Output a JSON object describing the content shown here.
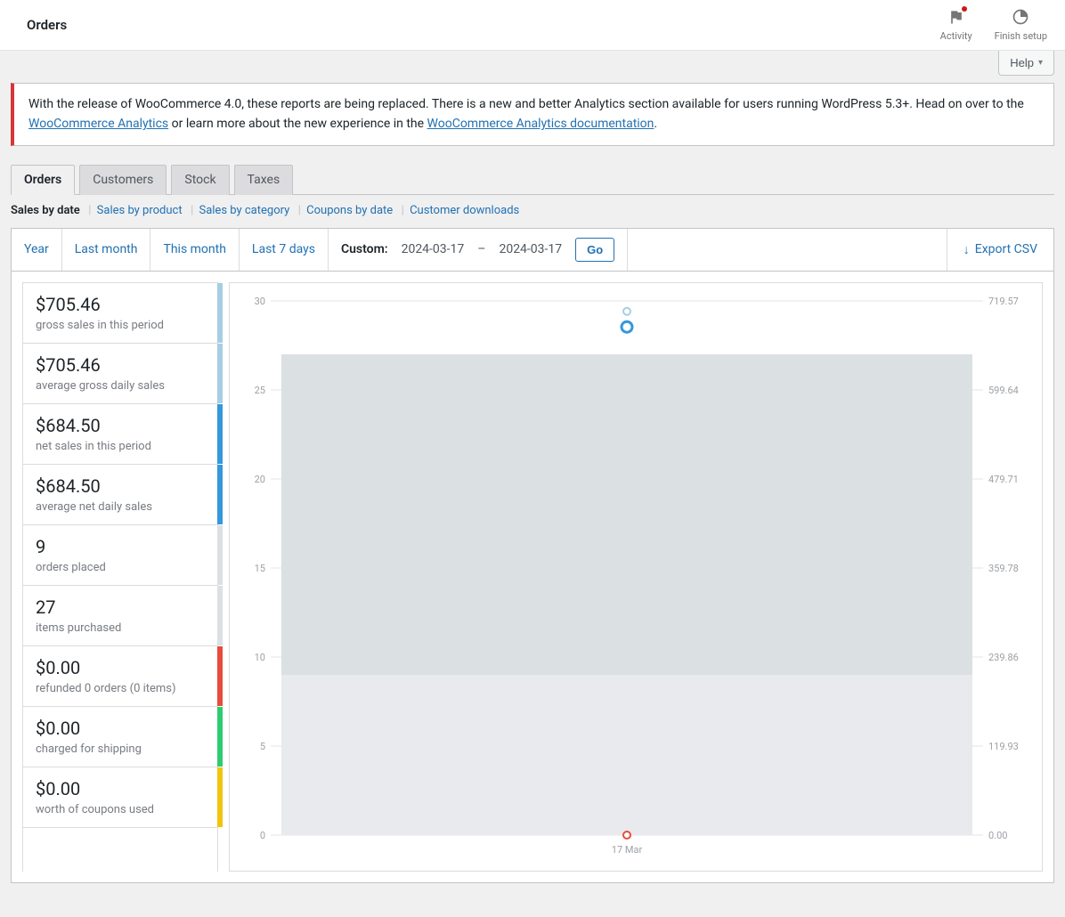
{
  "header": {
    "title": "Orders",
    "activity_label": "Activity",
    "finish_label": "Finish setup"
  },
  "help_label": "Help",
  "notice": {
    "pre": "With the release of WooCommerce 4.0, these reports are being replaced. There is a new and better Analytics section available for users running WordPress 5.3+. Head on over to the ",
    "link1": "WooCommerce Analytics",
    "mid": " or learn more about the new experience in the ",
    "link2": "WooCommerce Analytics documentation",
    "post": "."
  },
  "tabs": [
    "Orders",
    "Customers",
    "Stock",
    "Taxes"
  ],
  "subnav": {
    "current": "Sales by date",
    "links": [
      "Sales by product",
      "Sales by category",
      "Coupons by date",
      "Customer downloads"
    ]
  },
  "ranges": [
    "Year",
    "Last month",
    "This month",
    "Last 7 days"
  ],
  "custom": {
    "label": "Custom:",
    "from": "2024-03-17",
    "dash": "–",
    "to": "2024-03-17",
    "go": "Go"
  },
  "export_label": "Export CSV",
  "stats": [
    {
      "val": "$705.46",
      "lbl": "gross sales in this period",
      "clr": "#a6cee3"
    },
    {
      "val": "$705.46",
      "lbl": "average gross daily sales",
      "clr": "#a6cee3"
    },
    {
      "val": "$684.50",
      "lbl": "net sales in this period",
      "clr": "#3498db"
    },
    {
      "val": "$684.50",
      "lbl": "average net daily sales",
      "clr": "#3498db"
    },
    {
      "val": "9",
      "lbl": "orders placed",
      "clr": "#dbe0e3"
    },
    {
      "val": "27",
      "lbl": "items purchased",
      "clr": "#dbe0e3"
    },
    {
      "val": "$0.00",
      "lbl": "refunded 0 orders (0 items)",
      "clr": "#e74c3c"
    },
    {
      "val": "$0.00",
      "lbl": "charged for shipping",
      "clr": "#2ecc71"
    },
    {
      "val": "$0.00",
      "lbl": "worth of coupons used",
      "clr": "#f1c40f"
    }
  ],
  "chart_data": {
    "type": "bar",
    "categories": [
      "17 Mar"
    ],
    "left_axis": {
      "min": 0,
      "max": 30,
      "ticks": [
        0,
        5,
        10,
        15,
        20,
        25,
        30
      ],
      "label": ""
    },
    "right_axis": {
      "min": 0,
      "max": 719.57,
      "ticks": [
        0.0,
        119.93,
        239.86,
        359.78,
        479.71,
        599.64,
        719.57
      ],
      "label": ""
    },
    "series": [
      {
        "name": "items purchased",
        "axis": "left",
        "type": "bar",
        "color": "#dbe0e3",
        "values": [
          27
        ]
      },
      {
        "name": "orders placed",
        "axis": "left",
        "type": "bar",
        "color": "#e8eaed",
        "values": [
          9
        ]
      },
      {
        "name": "gross sales",
        "axis": "right",
        "type": "point",
        "color": "#a6cee3",
        "values": [
          705.46
        ]
      },
      {
        "name": "net sales",
        "axis": "right",
        "type": "point",
        "color": "#3498db",
        "values": [
          684.5
        ]
      },
      {
        "name": "refunds",
        "axis": "right",
        "type": "point",
        "color": "#e74c3c",
        "values": [
          0.0
        ]
      }
    ]
  }
}
